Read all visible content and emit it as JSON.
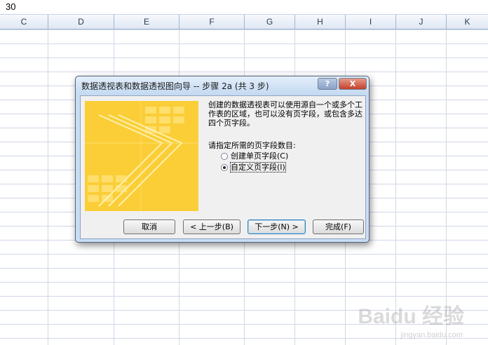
{
  "formula_bar": {
    "value": "30"
  },
  "columns": [
    "C",
    "D",
    "E",
    "F",
    "G",
    "H",
    "I",
    "J",
    "K"
  ],
  "dialog": {
    "title": "数据透视表和数据透视图向导 -- 步骤 2a (共 3 步)",
    "help_label": "?",
    "close_label": "X",
    "description": "创建的数据透视表可以使用源自一个或多个工作表的区域，也可以没有页字段，或包含多达四个页字段。",
    "prompt": "请指定所需的页字段数目:",
    "options": [
      {
        "label": "创建单页字段(C)",
        "selected": false
      },
      {
        "label": "自定义页字段(I)",
        "selected": true
      }
    ],
    "buttons": {
      "cancel": "取消",
      "back": "< 上一步(B)",
      "next": "下一步(N) >",
      "finish": "完成(F)"
    }
  },
  "watermark": {
    "brand": "Baidu 经验",
    "url": "jingyan.baidu.com"
  },
  "colors": {
    "image_fill": "#fbc51d",
    "title_bg": "#c4d9f1",
    "grid": "#d0d7e5"
  }
}
